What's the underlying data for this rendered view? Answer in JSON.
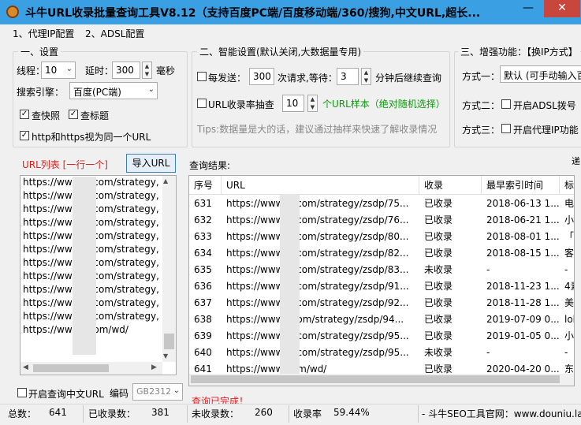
{
  "window": {
    "title": "斗牛URL收录批量查询工具V8.12（支持百度PC端/百度移动端/360/搜狗,中文URL,超长...",
    "minimize": "—",
    "close": "✕"
  },
  "menu": [
    "1、代理IP配置",
    "2、ADSL配置"
  ],
  "settings": {
    "legend": "一、设置",
    "threads_label": "线程：",
    "threads_value": "10",
    "delay_label": "延时：",
    "delay_value": "300",
    "delay_unit": "毫秒",
    "engine_label": "搜索引擎：",
    "engine_value": "百度(PC端)",
    "check_snapshot": "查快照",
    "check_title": "查标题",
    "http_same": "http和https视为同一个URL"
  },
  "smart": {
    "legend": "二、智能设置(默认关闭,大数据量专用)",
    "every_send": "每发送：",
    "send_count": "300",
    "requests_wait": "次请求,等待：",
    "wait_minutes": "3",
    "resume_text": "分钟后继续查询",
    "sample_label": "URL收录率抽查",
    "sample_count": "10",
    "sample_note": "个URL样本（绝对随机选择）",
    "tips": "Tips:数据量是大的话，建议通过抽样来快速了解收录情况"
  },
  "enhance": {
    "legend": "三、增强功能：【换IP方式】",
    "mode1_label": "方式一：",
    "mode1_value": "默认 (可手动输入百",
    "mode2_label": "方式二：",
    "mode2_text": "开启ADSL拨号",
    "mode3_label": "方式三：",
    "mode3_text": "开启代理IP功能"
  },
  "url_list": {
    "label": "URL列表 [一行一个]",
    "import_button": "导入URL",
    "lines": [
      "https://www.      z.com/strategy,",
      "https://www.      z.com/strategy,",
      "https://www.      z.com/strategy,",
      "https://www.      z.com/strategy,",
      "https://www.      z.com/strategy,",
      "https://www.      z.com/strategy,",
      "https://www.c     .com/strategy,",
      "https://www.c     .com/strategy,",
      "https://www.c     .com/strategy,",
      "https://www.c     .com/strategy,",
      "https://www.c     .com/strategy,",
      "https://www.      .com/wd/"
    ]
  },
  "chinese_url": {
    "label": "开启查询中文URL",
    "encoding_label": "编码",
    "encoding_value": "GB2312"
  },
  "results": {
    "label": "查询结果:",
    "right_edge": "递",
    "columns": [
      "序号",
      "URL",
      "收录",
      "最早索引时间",
      "标"
    ],
    "rows": [
      [
        "631",
        "https://www.      z.com/strategy/zsdp/75...",
        "已收录",
        "2018-06-13 1...",
        "电"
      ],
      [
        "632",
        "https://www.      z.com/strategy/zsdp/76...",
        "已收录",
        "2018-06-21 1...",
        "小"
      ],
      [
        "633",
        "https://www.      z.com/strategy/zsdp/80...",
        "已收录",
        "2018-08-01 1...",
        "「"
      ],
      [
        "634",
        "https://www.      z.com/strategy/zsdp/82...",
        "已收录",
        "2018-08-15 1...",
        "客"
      ],
      [
        "635",
        "https://www.      z.com/strategy/zsdp/83...",
        "未收录",
        "-",
        "-"
      ],
      [
        "636",
        "https://www.c     .com/strategy/zsdp/91...",
        "已收录",
        "2018-11-23 1...",
        "4素"
      ],
      [
        "637",
        "https://www.      z.com/strategy/zsdp/92...",
        "已收录",
        "2018-11-28 1...",
        "美"
      ],
      [
        "638",
        "https://www.      .com/strategy/zsdp/94...",
        "已收录",
        "2019-07-09 0...",
        "lol"
      ],
      [
        "639",
        "https://www.c     .com/strategy/zsdp/95...",
        "已收录",
        "2019-01-05 0...",
        "小"
      ],
      [
        "640",
        "https://www.c     .com/strategy/zsdp/95...",
        "未收录",
        "-",
        "-"
      ],
      [
        "641",
        "https://www.      .om/wd/",
        "已收录",
        "2020-04-20 0...",
        "东"
      ]
    ]
  },
  "status_message": "查询已完成！",
  "statusbar": {
    "total_label": "总数：",
    "total": "641",
    "indexed_label": "已收录数：",
    "indexed": "381",
    "unindexed_label": "未收录数：",
    "unindexed": "260",
    "rate_label": "收录率",
    "rate": "59.44%",
    "site": "- 斗牛SEO工具官网：www.douniu.la"
  }
}
